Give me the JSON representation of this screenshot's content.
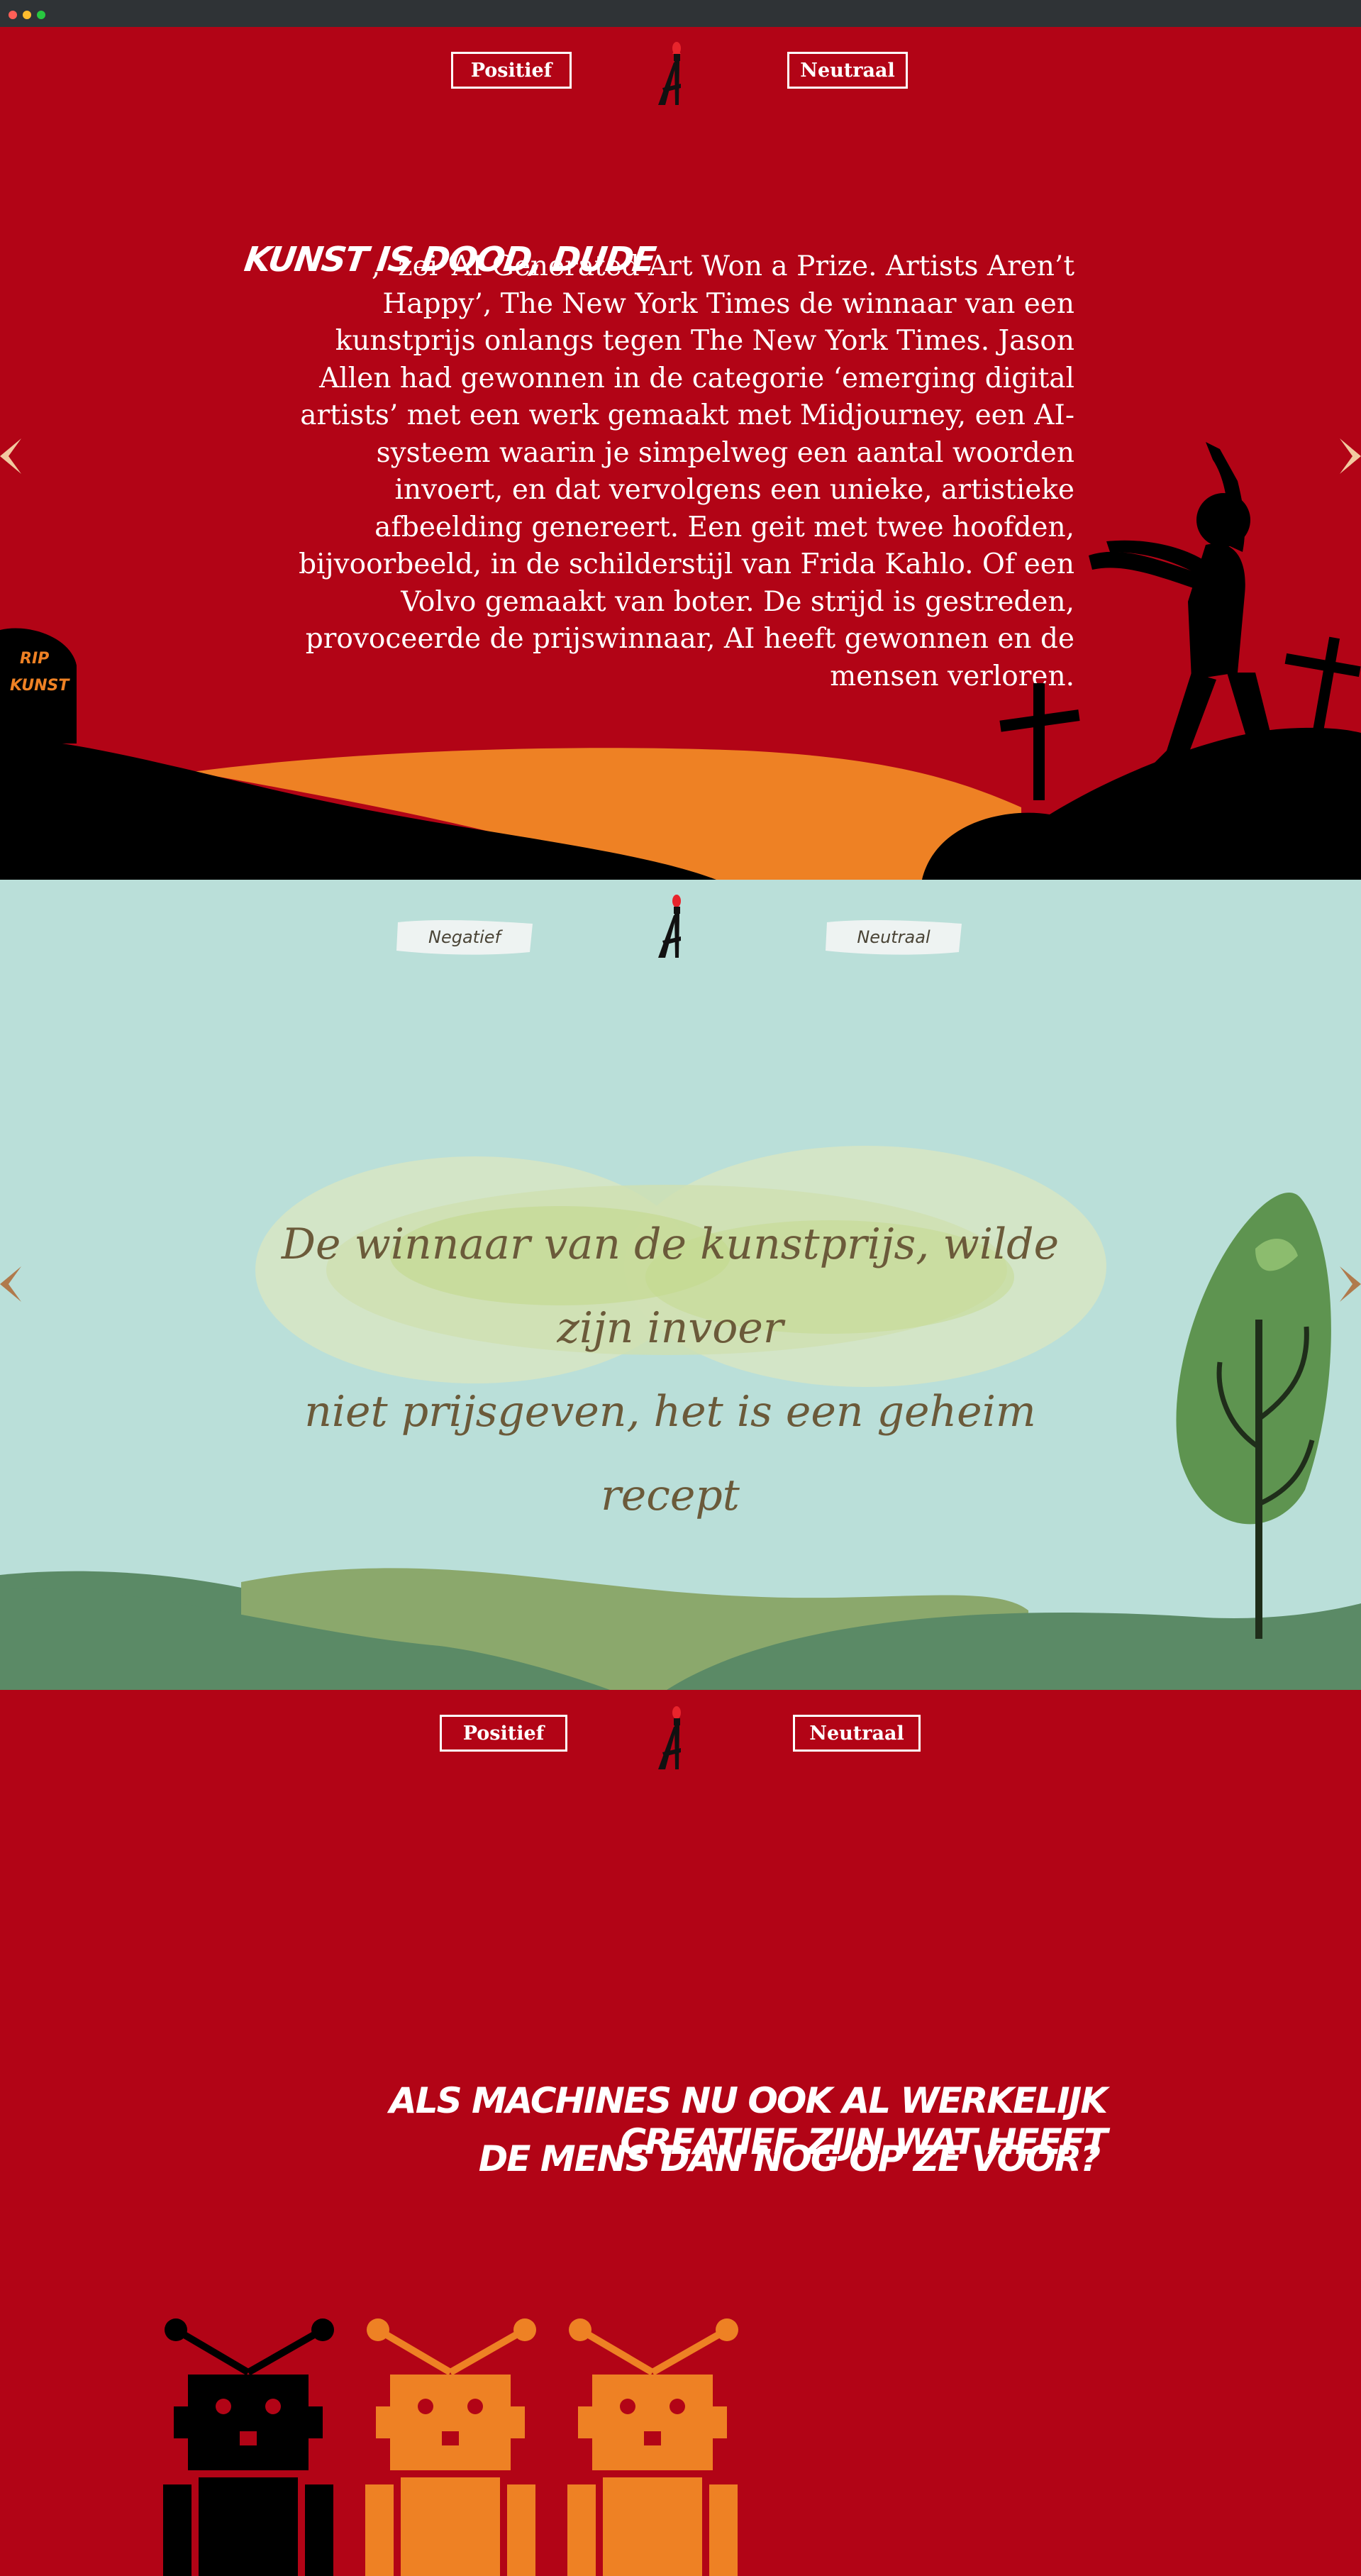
{
  "browser": {
    "dots": [
      "#ff5f57",
      "#febc2e",
      "#28c840"
    ]
  },
  "section1": {
    "nav": {
      "left_label": "Positief",
      "right_label": "Neutraal"
    },
    "logo_alt": "AI",
    "headline": "KUNST IS DOOD, DUDE",
    "paragraph": ",’ zei ‘AI-Generated Art Won a Prize. Artists Aren’t Happy’, The New York Times de winnaar van een kunstprijs onlangs tegen The New York Times. Jason Allen had gewonnen in de categorie ‘emerging digital artists’ met een werk gemaakt met Midjourney, een AI-systeem waarin je simpelweg een aantal woorden invoert, en dat vervolgens een unieke, artistieke afbeelding genereert. Een geit met twee hoofden, bijvoorbeeld, in de schilderstijl van Frida Kahlo. Of een Volvo gemaakt van boter. De strijd is gestreden, provoceerde de prijswinnaar, AI heeft gewonnen en de mensen verloren.",
    "tombstone_text": [
      "RIP",
      "KUNST"
    ],
    "colors": {
      "background": "#b20416",
      "path": "#ee8124",
      "ground": "#000000"
    }
  },
  "section2": {
    "nav": {
      "left_label": "Negatief",
      "right_label": "Neutraal"
    },
    "quote_line1": "De winnaar van de kunstprijs, wilde zijn invoer",
    "quote_line2": "niet prijsgeven, het is een geheim recept",
    "colors": {
      "background": "#badfd9",
      "hills": "#5b8a66",
      "tree": "#5e9450"
    }
  },
  "section3": {
    "nav": {
      "left_label": "Positief",
      "right_label": "Neutraal"
    },
    "title_line1": "ALS MACHINES NU OOK AL WERKELIJK CREATIEF ZIJN WAT HEEFT",
    "title_line2": "DE MENS DAN NOG OP ZE VOOR?",
    "robot_colors": [
      "#000000",
      "#ee8124",
      "#ee8124"
    ]
  }
}
